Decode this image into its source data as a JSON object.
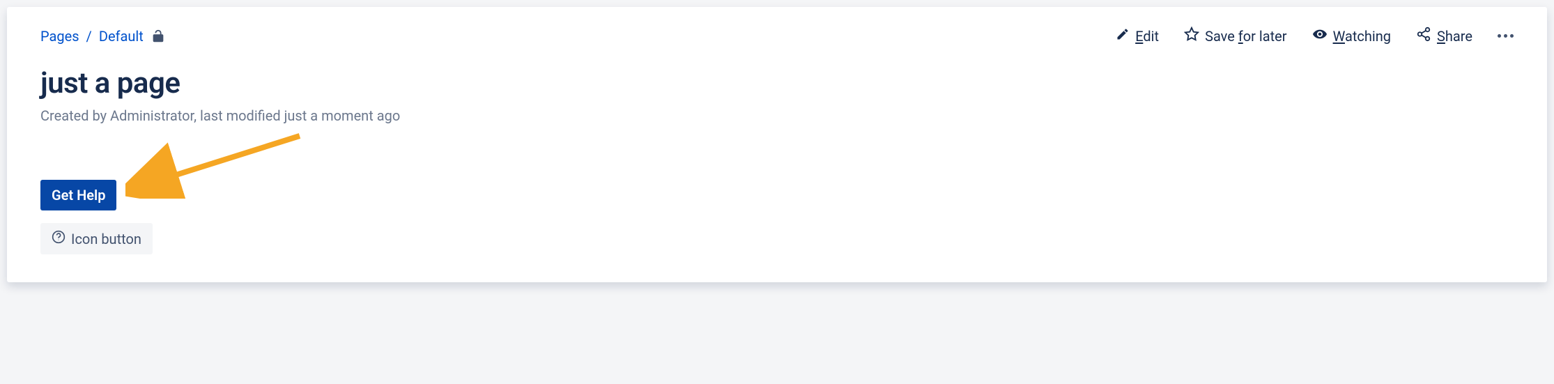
{
  "breadcrumb": {
    "root": "Pages",
    "current": "Default"
  },
  "actions": {
    "edit": {
      "accel": "E",
      "rest": "dit"
    },
    "save_for_later": {
      "pre": "Save ",
      "accel": "f",
      "post": "or later"
    },
    "watching": {
      "accel": "W",
      "rest": "atching"
    },
    "share": {
      "accel": "S",
      "rest": "hare"
    }
  },
  "page": {
    "title": "just a page",
    "meta": "Created by Administrator, last modified just a moment ago"
  },
  "buttons": {
    "get_help": "Get Help",
    "icon_button": "Icon button"
  }
}
